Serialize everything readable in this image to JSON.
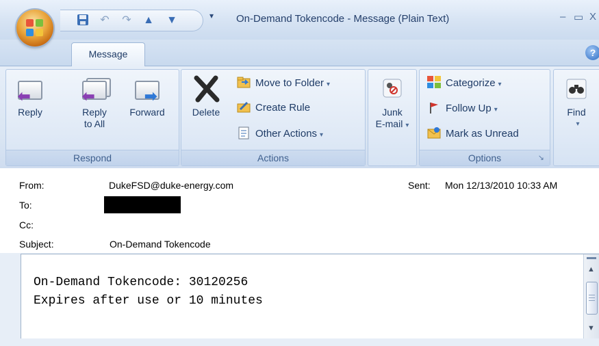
{
  "window": {
    "title": "On-Demand Tokencode - Message (Plain Text)",
    "minimize_glyph": "–",
    "maximize_glyph": "▭",
    "close_glyph": "X"
  },
  "quick_access": {
    "icons": [
      "save-icon",
      "undo-icon",
      "redo-icon",
      "previous-item-icon",
      "next-item-icon"
    ],
    "more_glyph": "▾"
  },
  "ribbon": {
    "active_tab": "Message",
    "help_glyph": "?",
    "groups": {
      "respond": {
        "label": "Respond",
        "reply": "Reply",
        "reply_all_1": "Reply",
        "reply_all_2": "to All",
        "forward": "Forward"
      },
      "actions": {
        "label": "Actions",
        "delete": "Delete",
        "move_to_folder": "Move to Folder",
        "create_rule": "Create Rule",
        "other_actions": "Other Actions"
      },
      "junk": {
        "label_1": "Junk",
        "label_2": "E-mail"
      },
      "options": {
        "label": "Options",
        "categorize": "Categorize",
        "follow_up": "Follow Up",
        "mark_unread": "Mark as Unread"
      },
      "find": {
        "label": "Find"
      }
    },
    "dropdown_glyph": "▾"
  },
  "header": {
    "from_label": "From:",
    "from_value": "DukeFSD@duke-energy.com",
    "to_label": "To:",
    "cc_label": "Cc:",
    "subject_label": "Subject:",
    "subject_value": "On-Demand Tokencode",
    "sent_label": "Sent:",
    "sent_value": "Mon 12/13/2010 10:33 AM"
  },
  "body": {
    "line1": "On-Demand Tokencode: 30120256",
    "line2": "Expires after use or 10 minutes"
  },
  "colors": {
    "accent": "#2d6cc2",
    "ribbon": "#d9e5f3",
    "text": "#1e3b66"
  }
}
